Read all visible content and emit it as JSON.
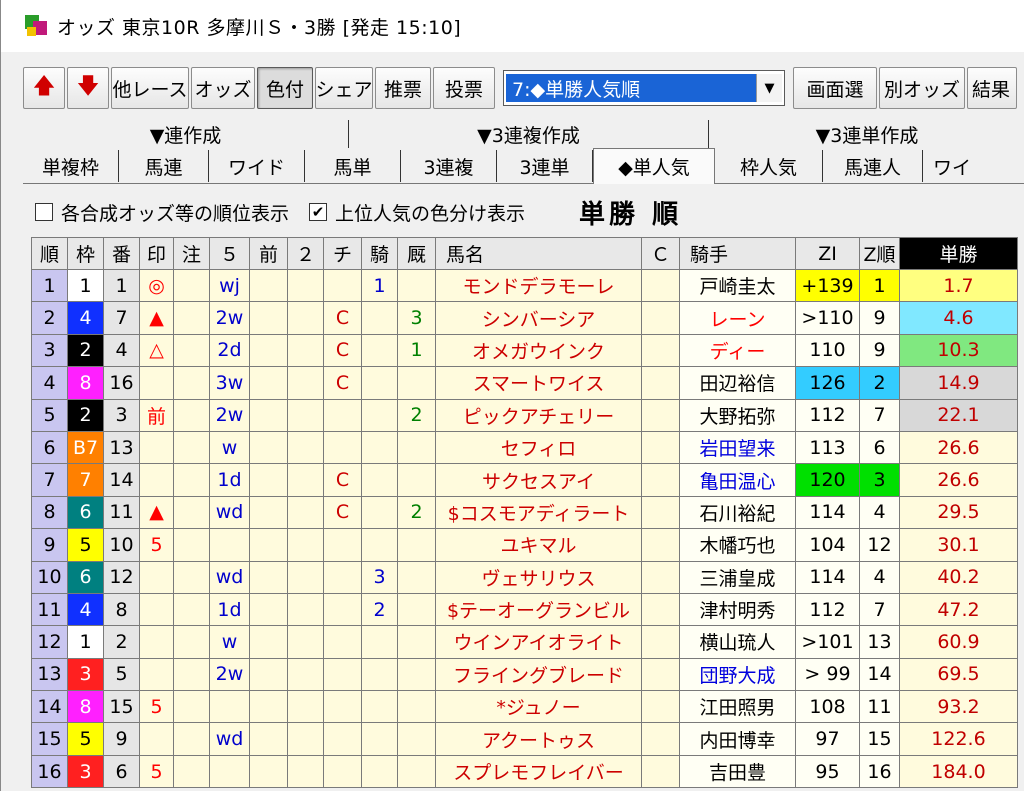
{
  "window": {
    "title": "オッズ 東京10R 多摩川Ｓ・3勝 [発走 15:10]"
  },
  "toolbar": {
    "buttons": [
      "他レース",
      "オッズ",
      "色付",
      "シェア",
      "推票",
      "投票"
    ],
    "select_value": "7:◆単勝人気順",
    "right_buttons": [
      "画面選",
      "別オッズ",
      "結果"
    ]
  },
  "categories": [
    "▼連作成",
    "▼3連複作成",
    "▼3連単作成"
  ],
  "tabs": [
    "単複枠",
    "馬連",
    "ワイド",
    "馬単",
    "3連複",
    "3連単",
    "◆単人気",
    "枠人気",
    "馬連人",
    "ワイ"
  ],
  "options": {
    "opt1": "各合成オッズ等の順位表示",
    "opt2": "上位人気の色分け表示",
    "opt1_checked": "",
    "opt2_checked": "✔",
    "sort_title": "単勝 順"
  },
  "columns": [
    "順",
    "枠",
    "番",
    "印",
    "注",
    "５",
    "前",
    "２",
    "チ",
    "騎",
    "厩",
    "馬名",
    "Ｃ",
    "騎手",
    "ZI",
    "Z順",
    "単勝"
  ],
  "colors": {
    "frame1": "#ffffff",
    "frame2": "#000000",
    "frame3": "#ff2020",
    "frame4": "#1030ff",
    "frame5": "#ffff00",
    "frame6": "#008080",
    "frame7": "#ff8000",
    "frame8": "#ff20ff",
    "zi_yellow": "#ffff00",
    "zi_cyan": "#33ccff",
    "zi_green": "#00e000",
    "odds_yellow": "#ffff80",
    "odds_cyan": "#80e8ff",
    "odds_green": "#80e880",
    "odds_gray": "#d8d8d8"
  },
  "rows": [
    {
      "rank": "1",
      "waku": "1",
      "ban": "1",
      "mark": "◎",
      "chu": "",
      "five": "wj",
      "mae": "",
      "two": "",
      "chi": "",
      "ki": "1",
      "kyu": "",
      "horse": "モンドデラモーレ",
      "c": "",
      "jockey": "戸崎圭太",
      "jstyle": "",
      "zi": "+139",
      "zr": "1",
      "odds": "1.7",
      "zihl": "zi_yellow",
      "ohl": "odds_yellow"
    },
    {
      "rank": "2",
      "waku": "4",
      "ban": "7",
      "mark": "▲",
      "chu": "",
      "five": "2w",
      "mae": "",
      "two": "",
      "chi": "C",
      "ki": "",
      "kyu": "3",
      "horse": "シンバーシア",
      "c": "",
      "jockey": "レーン",
      "jstyle": "red",
      "zi": ">110",
      "zr": "9",
      "odds": "4.6",
      "zihl": "",
      "ohl": "odds_cyan"
    },
    {
      "rank": "3",
      "waku": "2",
      "ban": "4",
      "mark": "△",
      "chu": "",
      "five": "2d",
      "mae": "",
      "two": "",
      "chi": "C",
      "ki": "",
      "kyu": "1",
      "horse": "オメガウインク",
      "c": "",
      "jockey": "ディー",
      "jstyle": "red",
      "zi": "110",
      "zr": "9",
      "odds": "10.3",
      "zihl": "",
      "ohl": "odds_green"
    },
    {
      "rank": "4",
      "waku": "8",
      "ban": "16",
      "mark": "",
      "chu": "",
      "five": "3w",
      "mae": "",
      "two": "",
      "chi": "C",
      "ki": "",
      "kyu": "",
      "horse": "スマートワイス",
      "c": "",
      "jockey": "田辺裕信",
      "jstyle": "",
      "zi": "126",
      "zr": "2",
      "odds": "14.9",
      "zihl": "zi_cyan",
      "ohl": "odds_gray"
    },
    {
      "rank": "5",
      "waku": "2",
      "ban": "3",
      "mark": "前",
      "chu": "",
      "five": "2w",
      "mae": "",
      "two": "",
      "chi": "",
      "ki": "",
      "kyu": "2",
      "horse": "ピックアチェリー",
      "c": "",
      "jockey": "大野拓弥",
      "jstyle": "",
      "zi": "112",
      "zr": "7",
      "odds": "22.1",
      "zihl": "",
      "ohl": "odds_gray"
    },
    {
      "rank": "6",
      "waku": "B7",
      "ban": "13",
      "mark": "",
      "chu": "",
      "five": "w",
      "mae": "",
      "two": "",
      "chi": "",
      "ki": "",
      "kyu": "",
      "horse": "セフィロ",
      "c": "",
      "jockey": "岩田望来",
      "jstyle": "blue",
      "zi": "113",
      "zr": "6",
      "odds": "26.6",
      "zihl": "",
      "ohl": ""
    },
    {
      "rank": "7",
      "waku": "7",
      "ban": "14",
      "mark": "",
      "chu": "",
      "five": "1d",
      "mae": "",
      "two": "",
      "chi": "C",
      "ki": "",
      "kyu": "",
      "horse": "サクセスアイ",
      "c": "",
      "jockey": "亀田温心",
      "jstyle": "blue",
      "zi": "120",
      "zr": "3",
      "odds": "26.6",
      "zihl": "zi_green",
      "ohl": ""
    },
    {
      "rank": "8",
      "waku": "6",
      "ban": "11",
      "mark": "▲",
      "chu": "",
      "five": "wd",
      "mae": "",
      "two": "",
      "chi": "C",
      "ki": "",
      "kyu": "2",
      "horse": "$コスモアディラート",
      "c": "",
      "jockey": "石川裕紀",
      "jstyle": "",
      "zi": "114",
      "zr": "4",
      "odds": "29.5",
      "zihl": "",
      "ohl": ""
    },
    {
      "rank": "9",
      "waku": "5",
      "ban": "10",
      "mark": "5",
      "chu": "",
      "five": "",
      "mae": "",
      "two": "",
      "chi": "",
      "ki": "",
      "kyu": "",
      "horse": "ユキマル",
      "c": "",
      "jockey": "木幡巧也",
      "jstyle": "",
      "zi": "104",
      "zr": "12",
      "odds": "30.1",
      "zihl": "",
      "ohl": ""
    },
    {
      "rank": "10",
      "waku": "6",
      "ban": "12",
      "mark": "",
      "chu": "",
      "five": "wd",
      "mae": "",
      "two": "",
      "chi": "",
      "ki": "3",
      "kyu": "",
      "horse": "ヴェサリウス",
      "c": "",
      "jockey": "三浦皇成",
      "jstyle": "",
      "zi": "114",
      "zr": "4",
      "odds": "40.2",
      "zihl": "",
      "ohl": ""
    },
    {
      "rank": "11",
      "waku": "4",
      "ban": "8",
      "mark": "",
      "chu": "",
      "five": "1d",
      "mae": "",
      "two": "",
      "chi": "",
      "ki": "2",
      "kyu": "",
      "horse": "$テーオーグランビル",
      "c": "",
      "jockey": "津村明秀",
      "jstyle": "",
      "zi": "112",
      "zr": "7",
      "odds": "47.2",
      "zihl": "",
      "ohl": ""
    },
    {
      "rank": "12",
      "waku": "1",
      "ban": "2",
      "mark": "",
      "chu": "",
      "five": "w",
      "mae": "",
      "two": "",
      "chi": "",
      "ki": "",
      "kyu": "",
      "horse": "ウインアイオライト",
      "c": "",
      "jockey": "横山琉人",
      "jstyle": "",
      "zi": ">101",
      "zr": "13",
      "odds": "60.9",
      "zihl": "",
      "ohl": ""
    },
    {
      "rank": "13",
      "waku": "3",
      "ban": "5",
      "mark": "",
      "chu": "",
      "five": "2w",
      "mae": "",
      "two": "",
      "chi": "",
      "ki": "",
      "kyu": "",
      "horse": "フライングブレード",
      "c": "",
      "jockey": "団野大成",
      "jstyle": "blue",
      "zi": ">  99",
      "zr": "14",
      "odds": "69.5",
      "zihl": "",
      "ohl": ""
    },
    {
      "rank": "14",
      "waku": "8",
      "ban": "15",
      "mark": "5",
      "chu": "",
      "five": "",
      "mae": "",
      "two": "",
      "chi": "",
      "ki": "",
      "kyu": "",
      "horse": "*ジュノー",
      "c": "",
      "jockey": "江田照男",
      "jstyle": "",
      "zi": "108",
      "zr": "11",
      "odds": "93.2",
      "zihl": "",
      "ohl": ""
    },
    {
      "rank": "15",
      "waku": "5",
      "ban": "9",
      "mark": "",
      "chu": "",
      "five": "wd",
      "mae": "",
      "two": "",
      "chi": "",
      "ki": "",
      "kyu": "",
      "horse": "アクートゥス",
      "c": "",
      "jockey": "内田博幸",
      "jstyle": "",
      "zi": "97",
      "zr": "15",
      "odds": "122.6",
      "zihl": "",
      "ohl": ""
    },
    {
      "rank": "16",
      "waku": "3",
      "ban": "6",
      "mark": "5",
      "chu": "",
      "five": "",
      "mae": "",
      "two": "",
      "chi": "",
      "ki": "",
      "kyu": "",
      "horse": "スプレモフレイバー",
      "c": "",
      "jockey": "吉田豊",
      "jstyle": "",
      "zi": "95",
      "zr": "16",
      "odds": "184.0",
      "zihl": "",
      "ohl": ""
    }
  ]
}
